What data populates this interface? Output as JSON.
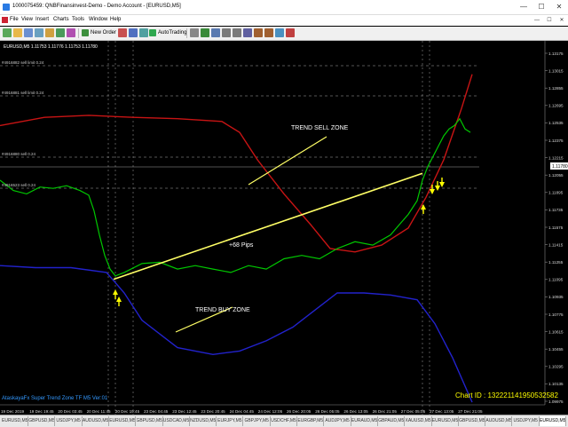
{
  "window": {
    "title": "1000075459: QNBFinansinvest-Demo - Demo Account - [EURUSD,M5]",
    "minimize": "—",
    "maximize": "☐",
    "close": "✕"
  },
  "menu": {
    "items": [
      "File",
      "View",
      "Insert",
      "Charts",
      "Tools",
      "Window",
      "Help"
    ]
  },
  "toolbar": {
    "new_order": "New Order",
    "autotrading": "AutoTrading"
  },
  "chart": {
    "header": "EURUSD,M5  1.11753 1.11776 1.11753 1.11780",
    "order_labels": [
      "#4916882 sell limit 0.24",
      "#4916881 sell limit 0.24",
      "#4916880 sell 0.24",
      "#4916523 sell 0.24"
    ],
    "annotations": {
      "sell_zone": "TREND SELL ZONE",
      "buy_zone": "TREND BUY  ZONE",
      "pips": "+68 Pips"
    },
    "indicator_name": "AtaskayaFx Super Trend Zone TF M5 Ver:01",
    "chart_id": "Chart ID : 1322211419505325​82",
    "price_ticks": [
      "1.13175",
      "1.13015",
      "1.12855",
      "1.12695",
      "1.12535",
      "1.12375",
      "1.12215",
      "1.12055",
      "1.11895",
      "1.11735",
      "1.11575",
      "1.11415",
      "1.11255",
      "1.11095",
      "1.10935",
      "1.10775",
      "1.10615",
      "1.10455",
      "1.10295",
      "1.10135",
      "1.09975"
    ],
    "current_price": "1.11780",
    "time_ticks": [
      "19 Dec 2019",
      "19 Dec 19:45",
      "20 Dec 03:45",
      "20 Dec 11:45",
      "20 Dec 19:45",
      "23 Dec 04:45",
      "23 Dec 12:45",
      "23 Dec 20:45",
      "24 Dec 04:45",
      "24 Dec 12:05",
      "26 Dec 20:05",
      "26 Dec 05:05",
      "26 Dec 13:05",
      "26 Dec 21:05",
      "27 Dec 05:05",
      "27 Dec 13:05",
      "27 Dec 21:05"
    ]
  },
  "tabs": [
    "EURUSD,M5",
    "GBPUSD,M5",
    "USDJPY,M5",
    "AUDUSD,M5",
    "EURUSD,M5",
    "GBPUSD,M5",
    "USDCAD,M5",
    "NZDUSD,M5",
    "EURJPY,M5",
    "GBPJPY,M5",
    "USDCHF,M5",
    "EURGBP,M5",
    "AUDJPY,M5",
    "EURAUD,M5",
    "GBPAUD,M5",
    "XAUUSD,M5",
    "EURUSD,M5",
    "GBPUSD,M5",
    "AUDUSD,M5",
    "USDJPY,M5",
    "EURUSD,M5"
  ],
  "colors": {
    "price_line": "#00c800",
    "upper_band": "#c81414",
    "lower_band": "#2222cc",
    "trend_line": "#ffff66",
    "annotation_text": "#ffffff",
    "indicator_text": "#3399ff",
    "chart_id_text": "#ffff00"
  },
  "chart_data": {
    "type": "line",
    "series": [
      {
        "key": "price",
        "x": [
          0,
          15,
          30,
          45,
          60,
          75,
          90,
          100,
          106,
          112,
          118,
          124,
          130,
          140,
          160,
          180,
          200,
          220,
          240,
          260,
          280,
          300,
          320,
          340,
          360,
          380,
          400,
          420,
          440,
          450,
          460,
          470,
          476,
          482,
          488,
          494,
          500,
          506,
          512,
          518,
          524,
          530
        ],
        "values": [
          1.114,
          1.1125,
          1.112,
          1.113,
          1.1128,
          1.1132,
          1.1125,
          1.1118,
          1.1095,
          1.106,
          1.103,
          1.101,
          1.1,
          1.1005,
          1.1018,
          1.102,
          1.101,
          1.1015,
          1.101,
          1.1005,
          1.1015,
          1.101,
          1.1025,
          1.103,
          1.1025,
          1.104,
          1.105,
          1.1045,
          1.106,
          1.1075,
          1.109,
          1.111,
          1.114,
          1.116,
          1.1175,
          1.119,
          1.1205,
          1.1215,
          1.122,
          1.123,
          1.1215,
          1.121
        ]
      },
      {
        "key": "upper",
        "x": [
          0,
          50,
          100,
          150,
          200,
          250,
          270,
          290,
          320,
          350,
          372,
          400,
          430,
          460,
          480,
          500,
          520,
          532
        ],
        "values": [
          1.122,
          1.1232,
          1.1235,
          1.1232,
          1.123,
          1.1226,
          1.121,
          1.117,
          1.112,
          1.1075,
          1.104,
          1.1035,
          1.1045,
          1.107,
          1.1115,
          1.117,
          1.1245,
          1.1295
        ]
      },
      {
        "key": "lower",
        "x": [
          0,
          40,
          80,
          120,
          140,
          160,
          200,
          240,
          270,
          300,
          330,
          350,
          380,
          410,
          440,
          470,
          490,
          510,
          532
        ],
        "values": [
          1.1015,
          1.1012,
          1.1012,
          1.1005,
          1.0975,
          1.0935,
          1.0895,
          1.0885,
          1.089,
          1.0905,
          1.0925,
          1.0945,
          1.0975,
          1.0975,
          1.0972,
          1.0965,
          1.093,
          1.088,
          1.0815
        ]
      }
    ],
    "trend_line": {
      "from": {
        "x": 128,
        "y": 1.0995
      },
      "to": {
        "x": 476,
        "y": 1.115
      }
    },
    "ylim": [
      1.0797,
      1.1344
    ]
  }
}
